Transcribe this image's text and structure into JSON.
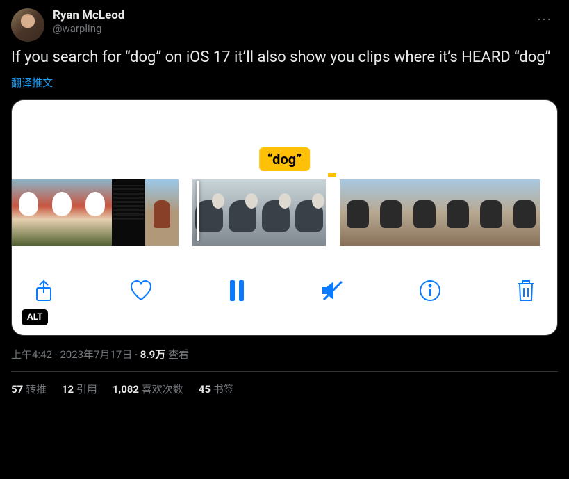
{
  "header": {
    "display_name": "Ryan McLeod",
    "handle": "@warpling"
  },
  "tweet_text": "If you search for “dog” on iOS 17 it’ll also show you clips where it’s HEARD “dog”",
  "translate_label": "翻译推文",
  "media": {
    "tag_text": "“dog”",
    "alt_badge": "ALT"
  },
  "meta": {
    "time": "上午4:42",
    "sep1": " · ",
    "date": "2023年7月17日",
    "sep2": " · ",
    "views_num": "8.9万",
    "views_label": " 查看"
  },
  "stats": {
    "retweets_num": "57",
    "retweets_label": " 转推",
    "quotes_num": "12",
    "quotes_label": " 引用",
    "likes_num": "1,082",
    "likes_label": " 喜欢次数",
    "bookmarks_num": "45",
    "bookmarks_label": " 书签"
  }
}
